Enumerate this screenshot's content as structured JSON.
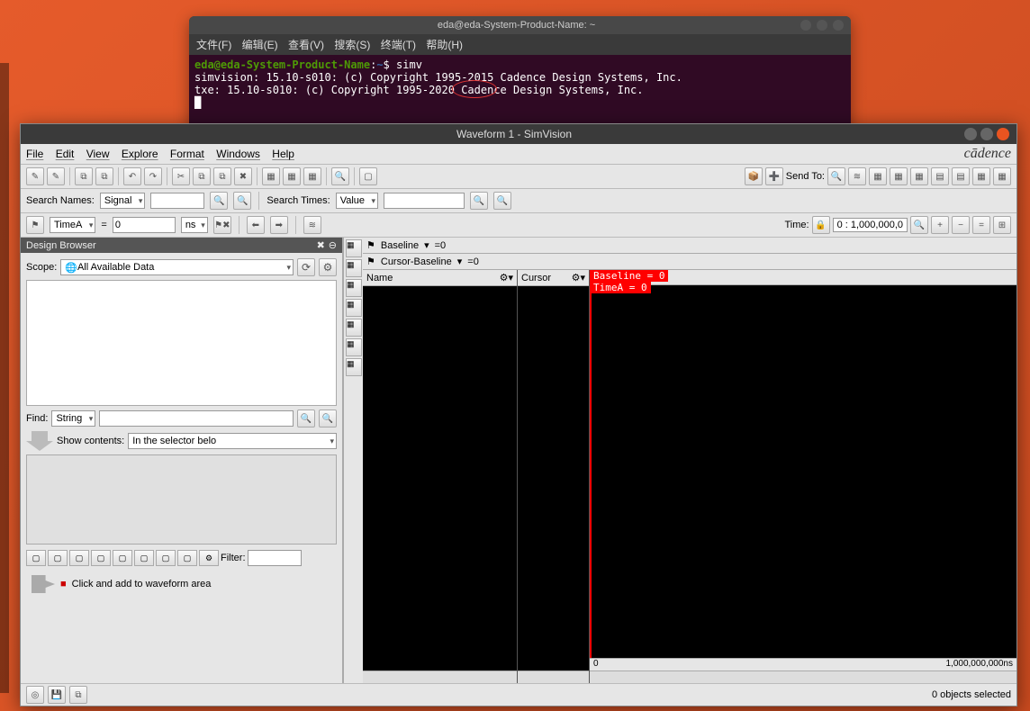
{
  "terminal": {
    "title": "eda@eda-System-Product-Name: ~",
    "menus": [
      "文件(F)",
      "编辑(E)",
      "查看(V)",
      "搜索(S)",
      "终端(T)",
      "帮助(H)"
    ],
    "prompt_user": "eda@eda-System-Product-Name",
    "prompt_path": "~",
    "prompt_sep": ":",
    "prompt_dollar": "$",
    "command": "simv",
    "line1": "simvision: 15.10-s010: (c) Copyright 1995-2015 Cadence Design Systems, Inc.",
    "line2": "txe: 15.10-s010: (c) Copyright 1995-2020 Cadence Design Systems, Inc."
  },
  "sim": {
    "title": "Waveform 1 - SimVision",
    "brand": "cādence",
    "menus": [
      "File",
      "Edit",
      "View",
      "Explore",
      "Format",
      "Windows",
      "Help"
    ],
    "search_names_label": "Search Names:",
    "search_names_mode": "Signal",
    "search_times_label": "Search Times:",
    "search_times_mode": "Value",
    "time_cursor_label": "TimeA",
    "time_cursor_eq": "=",
    "time_cursor_value": "0",
    "time_cursor_unit": "ns",
    "time_label": "Time:",
    "time_range": "0 : 1,000,000,0",
    "send_to_label": "Send To:",
    "design_browser": {
      "title": "Design Browser",
      "scope_label": "Scope:",
      "scope_value": "All Available Data",
      "find_label": "Find:",
      "find_mode": "String",
      "show_contents_label": "Show contents:",
      "show_contents_value": "In the selector belo",
      "filter_label": "Filter:",
      "hint": "Click and add to waveform area"
    },
    "wave": {
      "baseline_label": "Baseline",
      "baseline_value": "=0",
      "cursor_baseline_label": "Cursor-Baseline",
      "cursor_baseline_value": "=0",
      "name_col": "Name",
      "cursor_col": "Cursor",
      "badge1": "Baseline = 0",
      "badge2": "TimeA = 0",
      "zero_tick": "0",
      "end_tick": "1,000,000,000ns"
    },
    "status": "0 objects selected"
  }
}
